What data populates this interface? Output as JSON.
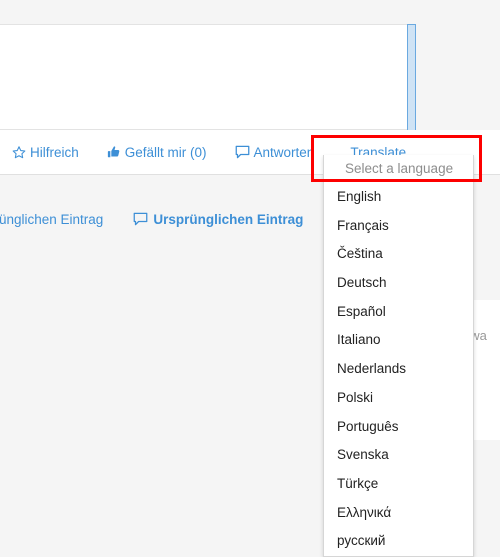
{
  "post": {
    "scrollbar_name": "post-body-scrollbar"
  },
  "action_bar": {
    "items": [
      {
        "label": "Hilfreich",
        "icon": "star-icon",
        "name": "helpful-button"
      },
      {
        "label": "Gefällt mir (0)",
        "icon": "thumbs-up-icon",
        "name": "like-button"
      },
      {
        "label": "Antworten",
        "icon": "speech-bubble-icon",
        "name": "reply-button"
      },
      {
        "label": "Translate",
        "icon": "none",
        "name": "translate-button"
      }
    ]
  },
  "links_row": {
    "items": [
      {
        "label": "Ursprünglichen Eintrag",
        "icon": "none",
        "bold": false
      },
      {
        "label": "Ursprünglichen Eintrag",
        "icon": "speech-bubble-icon",
        "bold": true
      }
    ]
  },
  "side_text": "ftwa",
  "dropdown": {
    "header": "Select a language",
    "items": [
      "English",
      "Français",
      "Čeština",
      "Deutsch",
      "Español",
      "Italiano",
      "Nederlands",
      "Polski",
      "Português",
      "Svenska",
      "Türkçe",
      "Ελληνικά",
      "русский"
    ]
  },
  "colors": {
    "link": "#3d8fd6",
    "highlight": "#fd0000",
    "page_bg": "#f5f5f5",
    "scrollbar": "#5ba3e0",
    "placeholder_text": "#8d8d8d"
  }
}
